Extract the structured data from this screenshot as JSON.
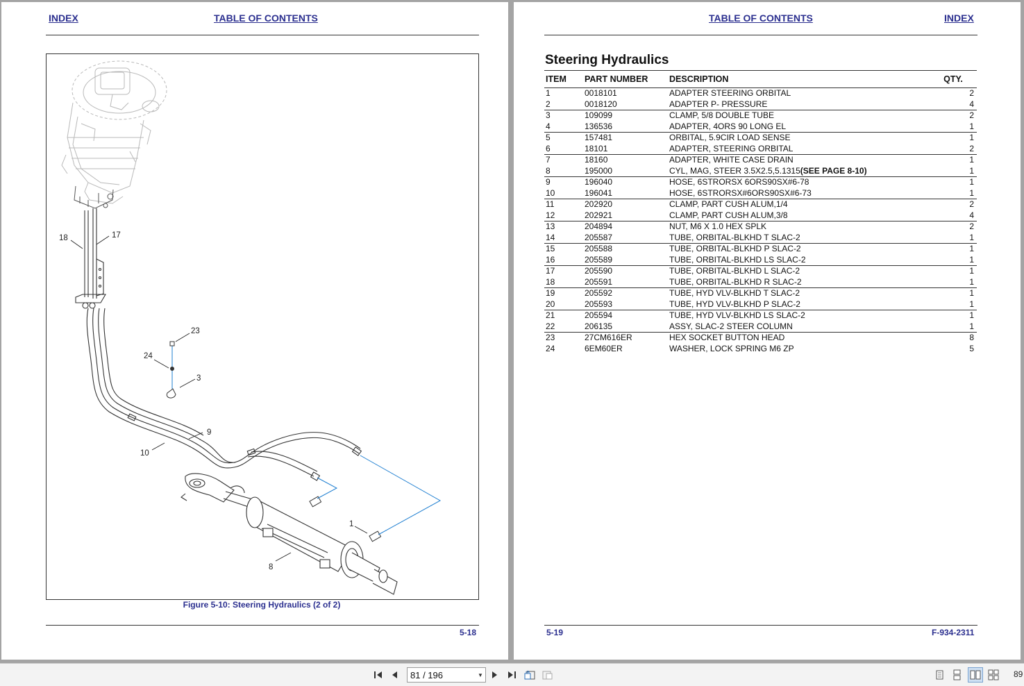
{
  "left_page": {
    "header": {
      "index_link": "INDEX",
      "toc_link": "TABLE OF CONTENTS"
    },
    "figure": {
      "caption": "Figure 5-10:  Steering Hydraulics (2 of 2)",
      "callouts": [
        "18",
        "17",
        "23",
        "24",
        "3",
        "9",
        "10",
        "1",
        "8"
      ]
    },
    "footer": {
      "page_number": "5-18"
    }
  },
  "right_page": {
    "header": {
      "toc_link": "TABLE OF CONTENTS",
      "index_link": "INDEX"
    },
    "section_title": "Steering Hydraulics",
    "table": {
      "headers": {
        "item": "ITEM",
        "part_number": "PART NUMBER",
        "description": "DESCRIPTION",
        "qty": "QTY."
      },
      "rows": [
        {
          "item": "1",
          "part": "0018101",
          "desc": "ADAPTER STEERING ORBITAL",
          "qty": "2"
        },
        {
          "item": "2",
          "part": "0018120",
          "desc": "ADAPTER P- PRESSURE",
          "qty": "4"
        },
        {
          "item": "3",
          "part": "109099",
          "desc": "CLAMP, 5/8 DOUBLE TUBE",
          "qty": "2"
        },
        {
          "item": "4",
          "part": "136536",
          "desc": "ADAPTER, 4ORS 90 LONG EL",
          "qty": "1"
        },
        {
          "item": "5",
          "part": "157481",
          "desc": "ORBITAL, 5.9CIR LOAD SENSE",
          "qty": "1"
        },
        {
          "item": "6",
          "part": "18101",
          "desc": "ADAPTER, STEERING ORBITAL",
          "qty": "2"
        },
        {
          "item": "7",
          "part": "18160",
          "desc": "ADAPTER, WHITE CASE DRAIN",
          "qty": "1"
        },
        {
          "item": "8",
          "part": "195000",
          "desc": "CYL, MAG, STEER 3.5X2.5,5.1315",
          "desc_bold": "(SEE PAGE 8-10)",
          "qty": "1"
        },
        {
          "item": "9",
          "part": "196040",
          "desc": "HOSE, 6STRORSX 6ORS90SX#6-78",
          "qty": "1"
        },
        {
          "item": "10",
          "part": "196041",
          "desc": "HOSE, 6STRORSX#6ORS90SX#6-73",
          "qty": "1"
        },
        {
          "item": "11",
          "part": "202920",
          "desc": "CLAMP, PART CUSH ALUM,1/4",
          "qty": "2"
        },
        {
          "item": "12",
          "part": "202921",
          "desc": "CLAMP, PART CUSH ALUM,3/8",
          "qty": "4"
        },
        {
          "item": "13",
          "part": "204894",
          "desc": "NUT, M6 X 1.0 HEX SPLK",
          "qty": "2"
        },
        {
          "item": "14",
          "part": "205587",
          "desc": "TUBE, ORBITAL-BLKHD T SLAC-2",
          "qty": "1"
        },
        {
          "item": "15",
          "part": "205588",
          "desc": "TUBE, ORBITAL-BLKHD P SLAC-2",
          "qty": "1"
        },
        {
          "item": "16",
          "part": "205589",
          "desc": "TUBE, ORBITAL-BLKHD LS SLAC-2",
          "qty": "1"
        },
        {
          "item": "17",
          "part": "205590",
          "desc": "TUBE, ORBITAL-BLKHD L SLAC-2",
          "qty": "1"
        },
        {
          "item": "18",
          "part": "205591",
          "desc": "TUBE, ORBITAL-BLKHD R SLAC-2",
          "qty": "1"
        },
        {
          "item": "19",
          "part": "205592",
          "desc": "TUBE, HYD VLV-BLKHD T SLAC-2",
          "qty": "1"
        },
        {
          "item": "20",
          "part": "205593",
          "desc": "TUBE, HYD VLV-BLKHD P SLAC-2",
          "qty": "1"
        },
        {
          "item": "21",
          "part": "205594",
          "desc": "TUBE, HYD VLV-BLKHD LS SLAC-2",
          "qty": "1"
        },
        {
          "item": "22",
          "part": "206135",
          "desc": "ASSY, SLAC-2 STEER COLUMN",
          "qty": "1"
        },
        {
          "item": "23",
          "part": "27CM616ER",
          "desc": "HEX SOCKET BUTTON HEAD",
          "qty": "8"
        },
        {
          "item": "24",
          "part": "6EM60ER",
          "desc": "WASHER, LOCK SPRING M6 ZP",
          "qty": "5"
        }
      ]
    },
    "footer": {
      "page_number": "5-19",
      "doc_number": "F-934-2311"
    }
  },
  "toolbar": {
    "page_indicator": "81 / 196",
    "zoom": "89",
    "icons": [
      "first-page-icon",
      "prev-page-icon",
      "next-page-icon",
      "last-page-icon",
      "rotate-back-icon",
      "rotate-forward-icon",
      "single-page-icon",
      "continuous-icon",
      "two-page-icon",
      "two-page-continuous-icon"
    ]
  },
  "colors": {
    "link": "#2b2f8f",
    "leader_blue": "#1f7fd1",
    "viewer_bg": "#a4a4a4"
  }
}
